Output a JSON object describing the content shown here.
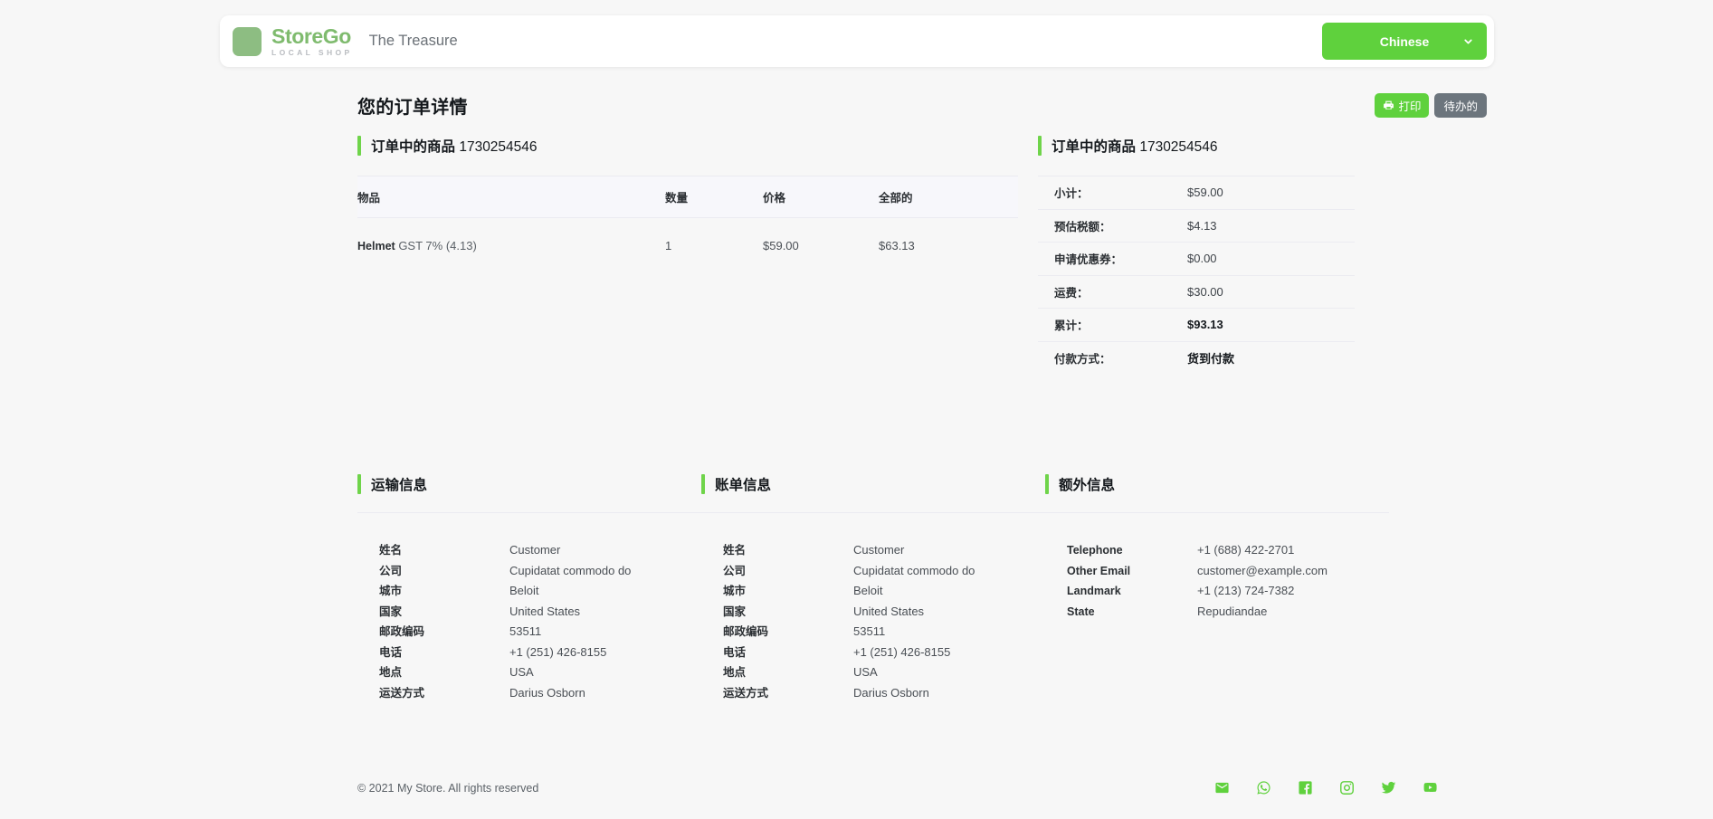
{
  "header": {
    "brand_name": "StoreGo",
    "brand_tagline": "LOCAL SHOP",
    "store_title": "The Treasure",
    "language_label": "Chinese",
    "language_options": [
      "Chinese"
    ],
    "brand_color": "#8dbd82",
    "accent_color": "#5fd13d"
  },
  "title_row": {
    "page_title": "您的订单详情",
    "print_label": "打印",
    "status_label": "待办的",
    "status_color": "#6c757d"
  },
  "items_section": {
    "heading": "订单中的商品",
    "order_number": "1730254546",
    "columns": [
      "物品",
      "数量",
      "价格",
      "全部的"
    ],
    "rows": [
      {
        "product": "Helmet",
        "tax": "GST 7% (4.13)",
        "qty": "1",
        "price": "$59.00",
        "total": "$63.13"
      }
    ]
  },
  "summary_section": {
    "heading": "订单中的商品",
    "order_number": "1730254546",
    "rows": [
      {
        "label": "小计：",
        "value": "$59.00",
        "strong": false
      },
      {
        "label": "预估税额：",
        "value": "$4.13",
        "strong": false
      },
      {
        "label": "申请优惠券：",
        "value": "$0.00",
        "strong": false
      },
      {
        "label": "运费：",
        "value": "$30.00",
        "strong": false
      },
      {
        "label": "累计：",
        "value": "$93.13",
        "strong": true
      },
      {
        "label": "付款方式：",
        "value": "货到付款",
        "strong": true
      }
    ]
  },
  "shipping_section": {
    "heading": "运输信息",
    "keys": [
      "姓名",
      "公司",
      "城市",
      "国家",
      "邮政编码",
      "电话",
      "地点",
      "运送方式"
    ],
    "values": [
      "Customer",
      "Cupidatat commodo do",
      "Beloit",
      "United States",
      "53511",
      "+1 (251) 426-8155",
      "USA",
      "Darius Osborn"
    ]
  },
  "billing_section": {
    "heading": "账单信息",
    "keys": [
      "姓名",
      "公司",
      "城市",
      "国家",
      "邮政编码",
      "电话",
      "地点",
      "运送方式"
    ],
    "values": [
      "Customer",
      "Cupidatat commodo do",
      "Beloit",
      "United States",
      "53511",
      "+1 (251) 426-8155",
      "USA",
      "Darius Osborn"
    ]
  },
  "extra_section": {
    "heading": "额外信息",
    "keys": [
      "Telephone",
      "Other Email",
      "Landmark",
      "State"
    ],
    "values": [
      "+1 (688) 422-2701",
      "customer@example.com",
      "+1 (213) 724-7382",
      "Repudiandae"
    ]
  },
  "footer": {
    "copyright": "© 2021 My Store. All rights reserved",
    "social_icons": [
      "email-icon",
      "whatsapp-icon",
      "facebook-icon",
      "instagram-icon",
      "twitter-icon",
      "youtube-icon"
    ],
    "social_color": "#5fd13d"
  }
}
